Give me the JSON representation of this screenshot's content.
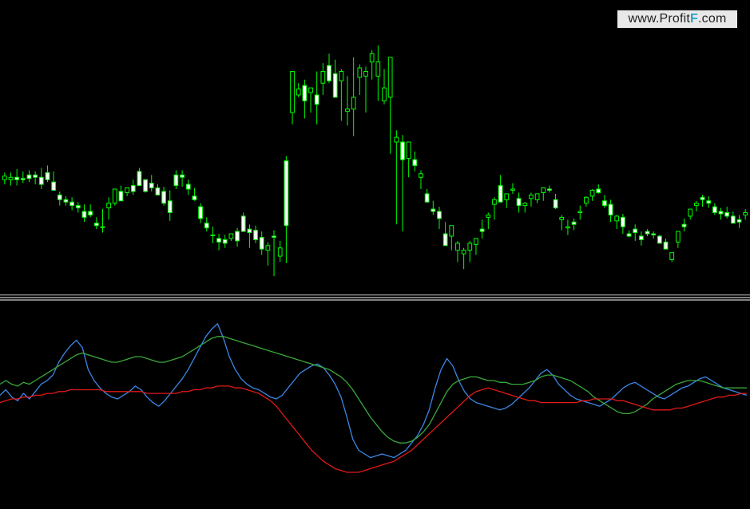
{
  "watermark": {
    "prefix": "www.Profit",
    "mark": "F",
    "suffix": ".com"
  },
  "colors": {
    "background": "#000000",
    "bull_body": "#000000",
    "bear_body": "#ffffff",
    "candle_wick": "#00ff00",
    "level_line": "#c0c0c0",
    "pane_separator": "#ffffff",
    "fast_line": "#3b87e6",
    "slow_line": "#3aa83a",
    "signal_line": "#e01919"
  },
  "chart_data": {
    "type": "candlestick",
    "price_pane": {
      "level_line": 50,
      "candles": [
        [
          148,
          154,
          144,
          151
        ],
        [
          148,
          154,
          143,
          150
        ],
        [
          150,
          157,
          143,
          148
        ],
        [
          149,
          155,
          145,
          148
        ],
        [
          152,
          156,
          146,
          149
        ],
        [
          152,
          155,
          144,
          150
        ],
        [
          150,
          158,
          140,
          144
        ],
        [
          154,
          160,
          146,
          148
        ],
        [
          146,
          155,
          143,
          139
        ],
        [
          135,
          138,
          126,
          131
        ],
        [
          131,
          134,
          126,
          129
        ],
        [
          129,
          133,
          122,
          126
        ],
        [
          126,
          129,
          120,
          124
        ],
        [
          121,
          127,
          112,
          116
        ],
        [
          121,
          127,
          116,
          118
        ],
        [
          111,
          116,
          106,
          109
        ],
        [
          108,
          123,
          103,
          108
        ],
        [
          124,
          133,
          114,
          128
        ],
        [
          128,
          137,
          126,
          140
        ],
        [
          138,
          143,
          137,
          130
        ],
        [
          137,
          140,
          134,
          141
        ],
        [
          143,
          148,
          135,
          138
        ],
        [
          155,
          158,
          143,
          143
        ],
        [
          148,
          148,
          137,
          138
        ],
        [
          145,
          152,
          138,
          141
        ],
        [
          141,
          144,
          135,
          135
        ],
        [
          138,
          142,
          126,
          128
        ],
        [
          130,
          139,
          113,
          120
        ],
        [
          152,
          156,
          140,
          143
        ],
        [
          152,
          156,
          142,
          150
        ],
        [
          144,
          148,
          135,
          140
        ],
        [
          134,
          141,
          130,
          131
        ],
        [
          125,
          128,
          111,
          115
        ],
        [
          111,
          116,
          104,
          107
        ],
        [
          101,
          108,
          94,
          101
        ],
        [
          98,
          102,
          88,
          95
        ],
        [
          97,
          101,
          90,
          94
        ],
        [
          98,
          102,
          96,
          102
        ],
        [
          104,
          107,
          91,
          96
        ],
        [
          117,
          120,
          106,
          104
        ],
        [
          106,
          110,
          90,
          103
        ],
        [
          105,
          109,
          94,
          97
        ],
        [
          99,
          104,
          84,
          89
        ],
        [
          88,
          95,
          75,
          92
        ],
        [
          100,
          105,
          66,
          99
        ],
        [
          83,
          96,
          78,
          90
        ],
        [
          164,
          168,
          77,
          109
        ],
        [
          205,
          213,
          195,
          240
        ],
        [
          220,
          230,
          218,
          225
        ],
        [
          228,
          233,
          200,
          215
        ],
        [
          222,
          226,
          205,
          226
        ],
        [
          220,
          240,
          195,
          212
        ],
        [
          230,
          247,
          220,
          240
        ],
        [
          245,
          255,
          230,
          232
        ],
        [
          238,
          250,
          225,
          218
        ],
        [
          232,
          242,
          198,
          240
        ],
        [
          206,
          236,
          194,
          208
        ],
        [
          208,
          252,
          185,
          218
        ],
        [
          235,
          246,
          220,
          243
        ],
        [
          236,
          244,
          205,
          240
        ],
        [
          248,
          258,
          233,
          255
        ],
        [
          236,
          262,
          215,
          248
        ],
        [
          215,
          242,
          212,
          226
        ],
        [
          218,
          232,
          170,
          252
        ],
        [
          180,
          190,
          110,
          184
        ],
        [
          180,
          186,
          104,
          165
        ],
        [
          166,
          172,
          150,
          180
        ],
        [
          165,
          172,
          155,
          160
        ],
        [
          150,
          156,
          140,
          153
        ],
        [
          136,
          140,
          130,
          129
        ],
        [
          123,
          130,
          118,
          121
        ],
        [
          121,
          125,
          106,
          115
        ],
        [
          102,
          112,
          96,
          92
        ],
        [
          100,
          104,
          88,
          109
        ],
        [
          88,
          96,
          78,
          94
        ],
        [
          85,
          90,
          72,
          88
        ],
        [
          88,
          96,
          78,
          94
        ],
        [
          93,
          97,
          84,
          98
        ],
        [
          106,
          114,
          98,
          104
        ],
        [
          116,
          120,
          106,
          118
        ],
        [
          127,
          133,
          114,
          131
        ],
        [
          143,
          152,
          138,
          129
        ],
        [
          131,
          136,
          124,
          136
        ],
        [
          139,
          145,
          136,
          140
        ],
        [
          132,
          137,
          120,
          126
        ],
        [
          126,
          129,
          120,
          128
        ],
        [
          132,
          137,
          125,
          135
        ],
        [
          131,
          135,
          128,
          136
        ],
        [
          137,
          140,
          130,
          141
        ],
        [
          140,
          143,
          137,
          139
        ],
        [
          131,
          136,
          123,
          124
        ],
        [
          114,
          118,
          105,
          116
        ],
        [
          107,
          114,
          101,
          108
        ],
        [
          112,
          115,
          105,
          110
        ],
        [
          120,
          126,
          114,
          121
        ],
        [
          128,
          134,
          125,
          133
        ],
        [
          134,
          140,
          130,
          139
        ],
        [
          140,
          144,
          136,
          137
        ],
        [
          130,
          135,
          124,
          126
        ],
        [
          127,
          131,
          112,
          118
        ],
        [
          113,
          118,
          106,
          117
        ],
        [
          116,
          119,
          102,
          108
        ],
        [
          102,
          105,
          99,
          100
        ],
        [
          106,
          110,
          96,
          103
        ],
        [
          100,
          104,
          92,
          97
        ],
        [
          104,
          106,
          100,
          102
        ],
        [
          102,
          104,
          98,
          101
        ],
        [
          100,
          101,
          97,
          94
        ],
        [
          95,
          98,
          90,
          89
        ],
        [
          80,
          85,
          78,
          86
        ],
        [
          95,
          104,
          90,
          104
        ],
        [
          110,
          115,
          104,
          108
        ],
        [
          117,
          122,
          114,
          123
        ],
        [
          126,
          130,
          121,
          128
        ],
        [
          133,
          135,
          125,
          131
        ],
        [
          130,
          134,
          124,
          128
        ],
        [
          125,
          128,
          118,
          120
        ],
        [
          121,
          124,
          114,
          119
        ],
        [
          120,
          125,
          115,
          117
        ],
        [
          117,
          121,
          112,
          111
        ],
        [
          114,
          118,
          107,
          112
        ],
        [
          118,
          123,
          114,
          120
        ]
      ]
    },
    "indicator_pane": {
      "series": [
        {
          "key": "fast",
          "values": [
            52,
            55,
            51,
            49,
            53,
            50,
            54,
            58,
            60,
            63,
            70,
            75,
            79,
            82,
            78,
            66,
            60,
            56,
            53,
            51,
            50,
            52,
            54,
            57,
            55,
            51,
            48,
            46,
            49,
            53,
            57,
            61,
            66,
            72,
            78,
            84,
            88,
            91,
            83,
            73,
            66,
            61,
            58,
            56,
            55,
            53,
            51,
            50,
            52,
            56,
            60,
            64,
            66,
            68,
            69,
            67,
            63,
            58,
            51,
            40,
            28,
            22,
            20,
            18,
            19,
            20,
            19,
            18,
            20,
            22,
            26,
            30,
            36,
            44,
            56,
            66,
            72,
            68,
            60,
            54,
            50,
            48,
            47,
            46,
            45,
            44,
            45,
            47,
            50,
            53,
            56,
            60,
            64,
            66,
            63,
            58,
            55,
            52,
            50,
            49,
            48,
            47,
            46,
            48,
            50,
            53,
            56,
            58,
            59,
            57,
            55,
            53,
            51,
            50,
            52,
            54,
            56,
            57,
            59,
            61,
            62,
            60,
            58,
            56,
            55,
            54,
            53,
            52
          ]
        },
        {
          "key": "slow",
          "values": [
            58,
            60,
            58,
            57,
            59,
            58,
            60,
            62,
            64,
            66,
            68,
            70,
            72,
            74,
            75,
            74,
            73,
            72,
            71,
            70,
            70,
            71,
            72,
            73,
            73,
            72,
            71,
            70,
            70,
            71,
            72,
            73,
            75,
            77,
            79,
            81,
            83,
            84,
            84,
            83,
            82,
            81,
            80,
            79,
            78,
            77,
            76,
            75,
            74,
            73,
            72,
            71,
            70,
            69,
            68,
            67,
            66,
            64,
            62,
            59,
            55,
            50,
            45,
            40,
            36,
            32,
            29,
            27,
            26,
            26,
            27,
            29,
            32,
            36,
            42,
            48,
            54,
            58,
            60,
            61,
            62,
            62,
            61,
            60,
            60,
            59,
            59,
            58,
            58,
            58,
            59,
            60,
            62,
            63,
            63,
            62,
            61,
            60,
            58,
            56,
            54,
            51,
            49,
            47,
            45,
            43,
            42,
            42,
            43,
            45,
            47,
            50,
            52,
            54,
            56,
            58,
            59,
            60,
            60,
            60,
            59,
            58,
            57,
            56,
            56,
            56,
            56,
            56
          ]
        },
        {
          "key": "signal",
          "values": [
            48,
            49,
            50,
            50,
            51,
            51,
            52,
            52,
            53,
            53,
            54,
            54,
            55,
            55,
            55,
            55,
            55,
            55,
            54,
            54,
            54,
            54,
            54,
            54,
            54,
            53,
            53,
            53,
            53,
            53,
            53,
            54,
            54,
            55,
            55,
            56,
            56,
            57,
            57,
            57,
            56,
            56,
            55,
            54,
            53,
            51,
            49,
            46,
            42,
            38,
            34,
            30,
            26,
            22,
            19,
            16,
            14,
            12,
            11,
            10,
            10,
            10,
            11,
            12,
            13,
            14,
            15,
            16,
            18,
            20,
            22,
            25,
            28,
            31,
            34,
            37,
            40,
            43,
            46,
            49,
            52,
            54,
            55,
            56,
            55,
            54,
            53,
            52,
            51,
            50,
            49,
            49,
            48,
            48,
            48,
            48,
            48,
            48,
            48,
            49,
            49,
            50,
            50,
            50,
            50,
            49,
            49,
            48,
            47,
            46,
            45,
            44,
            44,
            44,
            44,
            45,
            45,
            46,
            47,
            48,
            49,
            50,
            51,
            51,
            52,
            52,
            53,
            53
          ]
        }
      ],
      "ylim": [
        0,
        100
      ]
    }
  }
}
